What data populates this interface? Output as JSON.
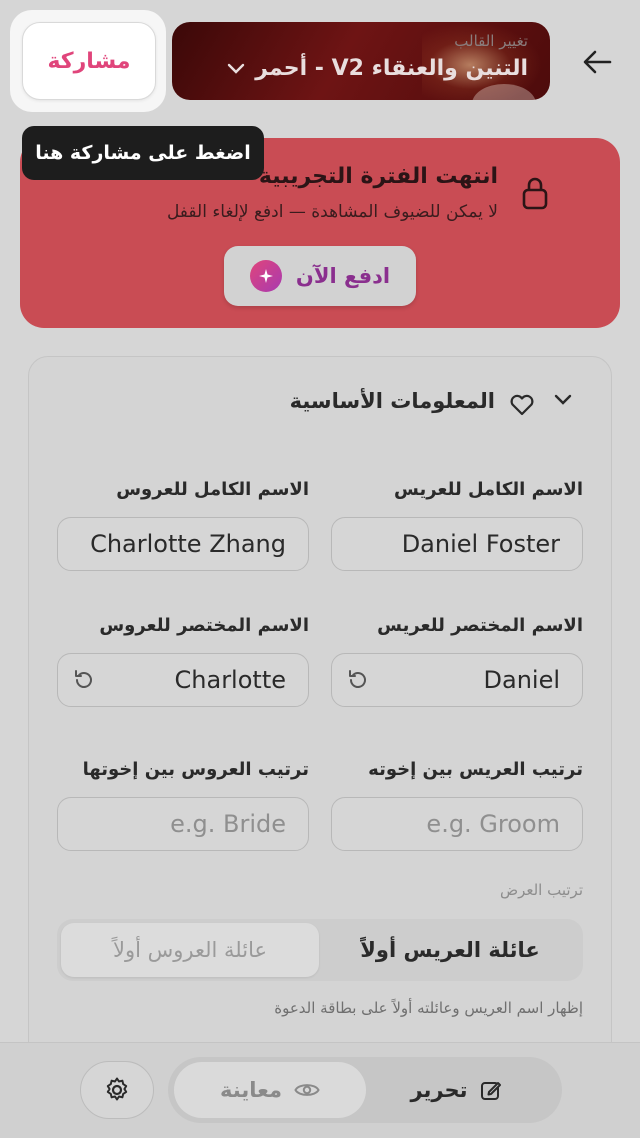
{
  "header": {
    "template_hint": "تغيير القالب",
    "template_name": "التنين والعنقاء V2 - أحمر",
    "share_label": "مشاركة",
    "tooltip": "اضغط على مشاركة هنا"
  },
  "trial": {
    "title": "انتهت الفترة التجريبية",
    "subtitle": "لا يمكن للضيوف المشاهدة — ادفع لإلغاء القفل",
    "pay_label": "ادفع الآن"
  },
  "basic_info": {
    "title": "المعلومات الأساسية",
    "groom_full_label": "الاسم الكامل للعريس",
    "groom_full_value": "Daniel Foster",
    "bride_full_label": "الاسم الكامل للعروس",
    "bride_full_value": "Charlotte Zhang",
    "groom_short_label": "الاسم المختصر للعريس",
    "groom_short_value": "Daniel",
    "bride_short_label": "الاسم المختصر للعروس",
    "bride_short_value": "Charlotte",
    "groom_order_label": "ترتيب العريس بين إخوته",
    "groom_order_placeholder": "e.g. Groom",
    "bride_order_label": "ترتيب العروس بين إخوتها",
    "bride_order_placeholder": "e.g. Bride",
    "display_order_label": "ترتيب العرض",
    "option_groom_first": "عائلة العريس أولاً",
    "option_bride_first": "عائلة العروس أولاً",
    "display_order_help": "إظهار اسم العريس وعائلته أولاً على بطاقة الدعوة"
  },
  "bottom_bar": {
    "edit_label": "تحرير",
    "preview_label": "معاينة"
  },
  "colors": {
    "accent_pink": "#e0457b",
    "trial_red": "#c94c54",
    "pay_purple": "#8a2f8e"
  }
}
